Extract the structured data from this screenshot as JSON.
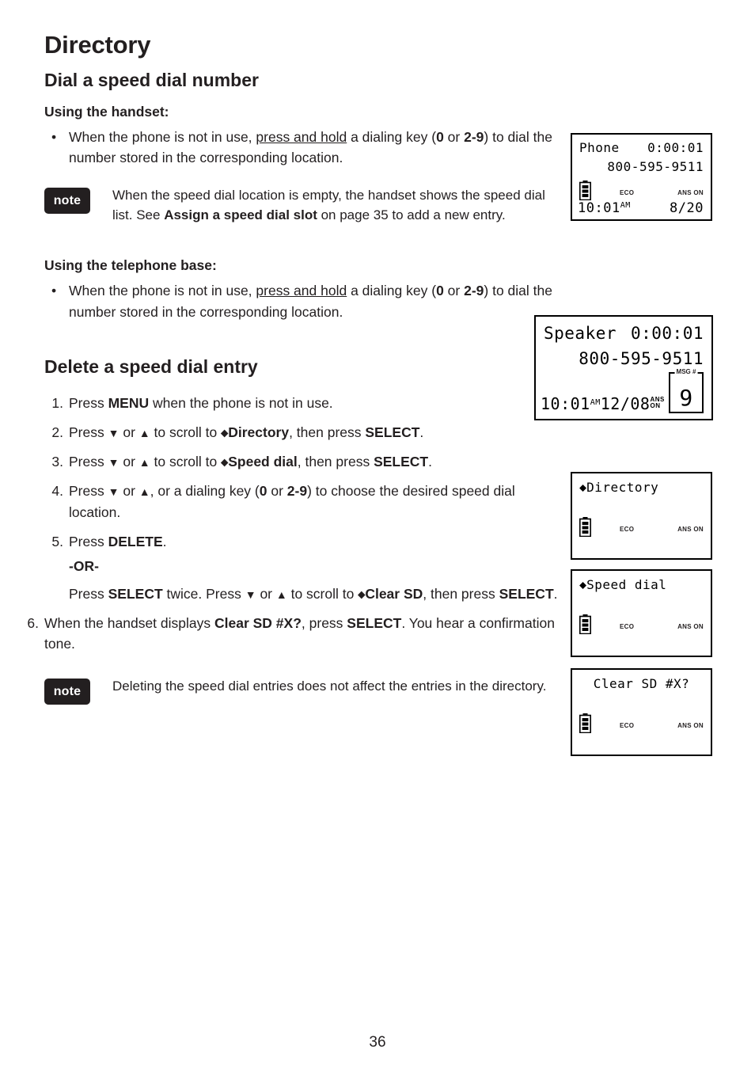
{
  "document": {
    "chapter_title": "Directory",
    "page_number": "36"
  },
  "sections": {
    "dial_speed_dial": {
      "heading": "Dial a speed dial number",
      "handset": {
        "subheading": "Using the handset:",
        "bullet": {
          "part1": "When the phone is not in use, ",
          "underlined": "press and hold",
          "part2": " a dialing key (",
          "key_a": "0",
          "or": " or ",
          "key_b": "2-9",
          "part3": ") to dial the number stored in the corresponding location."
        },
        "note": {
          "badge": "note",
          "text_part1": "When the speed dial location is empty, the handset shows the speed dial list. See ",
          "bold_ref": "Assign a speed dial slot",
          "text_part2": " on page 35 to add a new entry."
        }
      },
      "base": {
        "subheading": "Using the telephone base:",
        "bullet": {
          "part1": "When the phone is not in use, ",
          "underlined": "press and hold",
          "part2": " a dialing key (",
          "key_a": "0",
          "or": " or ",
          "key_b": "2-9",
          "part3": ") to dial the number stored in the corresponding location."
        }
      }
    },
    "delete_speed_dial": {
      "heading": "Delete a speed dial entry",
      "steps": [
        {
          "num": "1.",
          "t1": "Press ",
          "b1": "MENU",
          "t2": " when the phone is not in use."
        },
        {
          "num": "2.",
          "t1": "Press ",
          "down": "▼",
          "t2": " or ",
          "up": "▲",
          "t3": " to scroll to ",
          "arrow": "⬥",
          "b1": "Directory",
          "t4": ", then press ",
          "b2": "SELECT",
          "t5": "."
        },
        {
          "num": "3.",
          "t1": "Press ",
          "down": "▼",
          "t2": " or ",
          "up": "▲",
          "t3": " to scroll to ",
          "arrow": "⬥",
          "b1": "Speed dial",
          "t4": ", then press ",
          "b2": "SELECT",
          "t5": "."
        },
        {
          "num": "4.",
          "t1": "Press ",
          "down": "▼",
          "t2": " or ",
          "up": "▲",
          "t3": ", or a dialing key (",
          "b1": "0",
          "t4": " or ",
          "b2": "2-9",
          "t5": ") to choose the desired speed dial location."
        },
        {
          "num": "5.",
          "t1": "Press ",
          "b1": "DELETE",
          "t2": "."
        }
      ],
      "or_label": "-OR-",
      "or_para": {
        "t1": "Press ",
        "b1": "SELECT",
        "t2": " twice. Press ",
        "down": "▼",
        "t3": " or ",
        "up": "▲",
        "t4": " to scroll to ",
        "arrow": "⬥",
        "b2": "Clear SD",
        "t5": ", then press ",
        "b3": "SELECT",
        "t6": "."
      },
      "step6": {
        "num": "6.",
        "t1": "When the handset displays ",
        "b1": "Clear SD #X?",
        "t2": ", press ",
        "b2": "SELECT",
        "t3": ". You hear a confirmation tone."
      },
      "note": {
        "badge": "note",
        "text": "Deleting the speed dial entries does not affect the entries in the directory."
      }
    }
  },
  "lcd_screens": {
    "handset_call": {
      "label": "Phone",
      "timer": "0:00:01",
      "number": "800-595-9511",
      "eco": "ECO",
      "ans_on": "ANS ON",
      "time": "10:01",
      "ampm": "AM",
      "counter": "8/20"
    },
    "base_call": {
      "label": "Speaker",
      "timer": "0:00:01",
      "number": "800-595-9511",
      "time": "10:01",
      "ampm": "AM",
      "date": "12/08",
      "ans": "ANS",
      "on": "ON",
      "msg_label": "MSG #",
      "msg_count": "9"
    },
    "menu_directory": {
      "arrow": "⬥",
      "title": "Directory",
      "eco": "ECO",
      "ans_on": "ANS ON"
    },
    "menu_speed_dial": {
      "arrow": "⬥",
      "title": "Speed dial",
      "eco": "ECO",
      "ans_on": "ANS ON"
    },
    "menu_clear_sd": {
      "title": "Clear SD #X?",
      "eco": "ECO",
      "ans_on": "ANS ON"
    }
  }
}
